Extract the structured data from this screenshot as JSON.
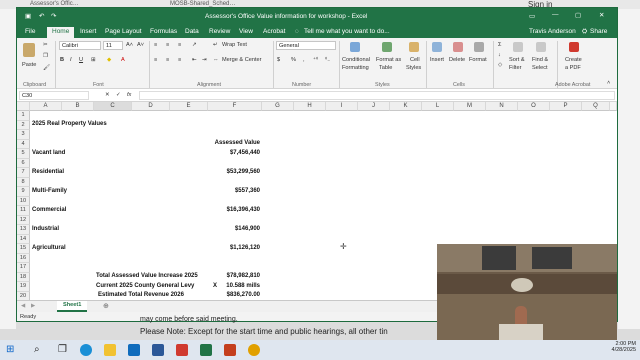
{
  "background": {
    "browser_tabs": [
      "Assessor's Offic…",
      "MOSB-Shared_Sched…"
    ],
    "sign_in": "Sign in",
    "page_text_1": "may come before said meeting.",
    "page_text_2": "Please Note:  Except for the start time and public hearings, all other tin"
  },
  "excel": {
    "title": "Assessor's Office Value information for workshop  -  Excel",
    "user": "Travis Anderson",
    "share_label": "Share",
    "tell_me": "Tell me what you want to do...",
    "tabs": [
      "File",
      "Home",
      "Insert",
      "Page Layout",
      "Formulas",
      "Data",
      "Review",
      "View",
      "Acrobat"
    ],
    "active_tab": "Home",
    "ribbon": {
      "clipboard": {
        "group": "Clipboard",
        "paste": "Paste"
      },
      "font": {
        "group": "Font",
        "font_name": "Calibri",
        "font_size": "11"
      },
      "alignment": {
        "group": "Alignment",
        "wrap_text": "Wrap Text",
        "merge_center": "Merge & Center"
      },
      "number": {
        "group": "Number",
        "format": "General"
      },
      "styles": {
        "group": "Styles",
        "conditional": "Conditional",
        "conditional2": "Formatting",
        "format_as": "Format as",
        "format_as2": "Table",
        "cell_styles": "Cell",
        "cell_styles2": "Styles"
      },
      "cells": {
        "group": "Cells",
        "insert": "Insert",
        "delete": "Delete",
        "format": "Format"
      },
      "editing": {
        "sort": "Sort &",
        "sort2": "Filter",
        "find": "Find &",
        "find2": "Select"
      },
      "adobe": {
        "group": "Adobe Acrobat",
        "create": "Create",
        "create2": "a PDF"
      }
    },
    "name_box": "C30",
    "fx": "fx",
    "columns": [
      "A",
      "B",
      "C",
      "D",
      "E",
      "F",
      "G",
      "H",
      "I",
      "J",
      "K",
      "L",
      "M",
      "N",
      "O",
      "P",
      "Q"
    ],
    "rows": [
      "1",
      "2",
      "3",
      "4",
      "5",
      "6",
      "7",
      "8",
      "9",
      "10",
      "11",
      "12",
      "13",
      "14",
      "15",
      "16",
      "17",
      "18",
      "19",
      "20"
    ],
    "cells": {
      "a1": "2025 Real Property Values",
      "f3": "Assessed Value",
      "a4": "Vacant land",
      "f4": "$7,456,440",
      "a6": "Residential",
      "f6": "$53,299,560",
      "a8": "Multi-Family",
      "f8": "$557,360",
      "a10": "Commercial",
      "f10": "$16,396,430",
      "a12": "Industrial",
      "f12": "$146,900",
      "a14": "Agricultural",
      "f14": "$1,126,120",
      "c17": "Total Assessed Value Increase 2025",
      "f17": "$78,982,810",
      "c18": "Current 2025 County General Levy",
      "e18": "X",
      "f18": "10.588 mills",
      "c19": "Estimated Total Revenue 2026",
      "f19": "$836,270.00"
    },
    "sheet_tab": "Sheet1",
    "status": "Ready"
  },
  "taskbar": {
    "time": "2:00 PM",
    "date": "4/28/2025"
  },
  "colors": {
    "excel_green": "#217346",
    "taskbar": "#dfe6ef"
  }
}
